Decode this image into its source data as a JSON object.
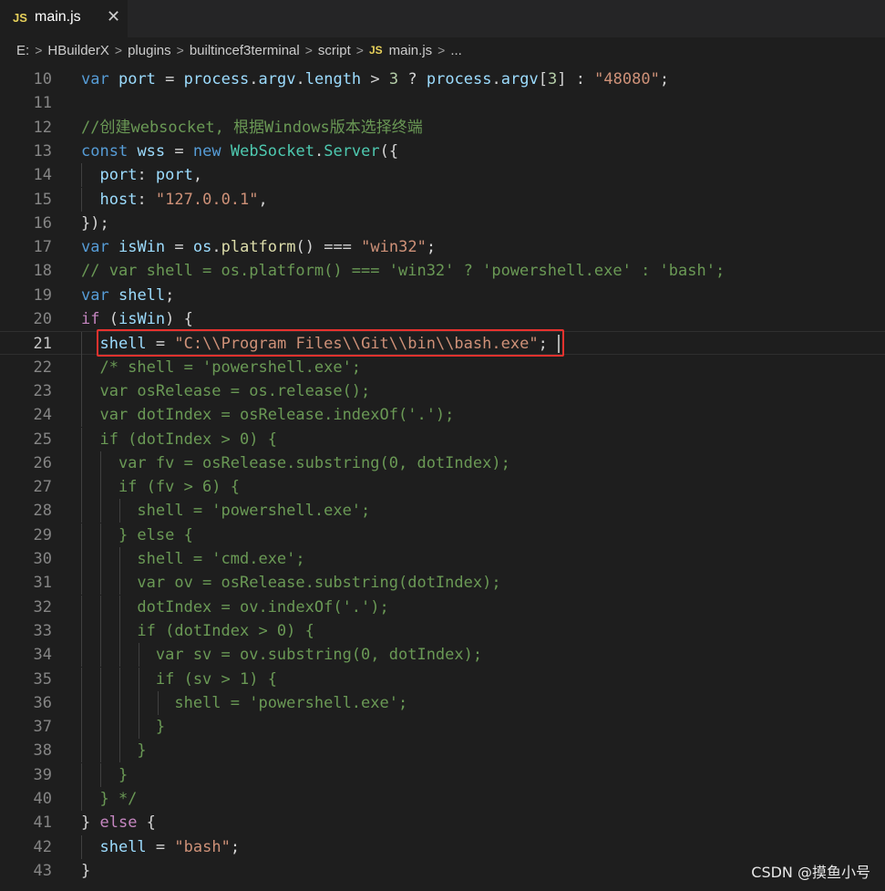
{
  "tab": {
    "badge": "JS",
    "filename": "main.js",
    "close": "✕"
  },
  "breadcrumb": {
    "items": [
      "E:",
      "HBuilderX",
      "plugins",
      "builtincef3terminal",
      "script",
      "main.js",
      "..."
    ],
    "badge": "JS",
    "separator": ">"
  },
  "editor": {
    "current_line": 21,
    "lines": [
      {
        "n": "10",
        "indent": 0,
        "t": [
          [
            "kw",
            "var"
          ],
          [
            "op",
            " "
          ],
          [
            "var",
            "port"
          ],
          [
            "op",
            " = "
          ],
          [
            "var",
            "process"
          ],
          [
            "op",
            "."
          ],
          [
            "var",
            "argv"
          ],
          [
            "op",
            "."
          ],
          [
            "var",
            "length"
          ],
          [
            "op",
            " > "
          ],
          [
            "num",
            "3"
          ],
          [
            "op",
            " ? "
          ],
          [
            "var",
            "process"
          ],
          [
            "op",
            "."
          ],
          [
            "var",
            "argv"
          ],
          [
            "op",
            "["
          ],
          [
            "num",
            "3"
          ],
          [
            "op",
            "] : "
          ],
          [
            "str",
            "\"48080\""
          ],
          [
            "op",
            ";"
          ]
        ]
      },
      {
        "n": "11",
        "indent": 0,
        "t": []
      },
      {
        "n": "12",
        "indent": 0,
        "t": [
          [
            "cm",
            "//创建websocket, 根据Windows版本选择终端"
          ]
        ]
      },
      {
        "n": "13",
        "indent": 0,
        "t": [
          [
            "kw",
            "const"
          ],
          [
            "op",
            " "
          ],
          [
            "var",
            "wss"
          ],
          [
            "op",
            " = "
          ],
          [
            "kw",
            "new"
          ],
          [
            "op",
            " "
          ],
          [
            "cls",
            "WebSocket"
          ],
          [
            "op",
            "."
          ],
          [
            "cls",
            "Server"
          ],
          [
            "op",
            "({"
          ]
        ]
      },
      {
        "n": "14",
        "indent": 1,
        "t": [
          [
            "op",
            "  "
          ],
          [
            "var",
            "port"
          ],
          [
            "op",
            ": "
          ],
          [
            "var",
            "port"
          ],
          [
            "op",
            ","
          ]
        ]
      },
      {
        "n": "15",
        "indent": 1,
        "t": [
          [
            "op",
            "  "
          ],
          [
            "var",
            "host"
          ],
          [
            "op",
            ": "
          ],
          [
            "str",
            "\"127.0.0.1\""
          ],
          [
            "op",
            ","
          ]
        ]
      },
      {
        "n": "16",
        "indent": 0,
        "t": [
          [
            "op",
            "});"
          ]
        ]
      },
      {
        "n": "17",
        "indent": 0,
        "t": [
          [
            "kw",
            "var"
          ],
          [
            "op",
            " "
          ],
          [
            "var",
            "isWin"
          ],
          [
            "op",
            " = "
          ],
          [
            "var",
            "os"
          ],
          [
            "op",
            "."
          ],
          [
            "fn",
            "platform"
          ],
          [
            "op",
            "() === "
          ],
          [
            "str",
            "\"win32\""
          ],
          [
            "op",
            ";"
          ]
        ]
      },
      {
        "n": "18",
        "indent": 0,
        "t": [
          [
            "cm",
            "// var shell = os.platform() === 'win32' ? 'powershell.exe' : 'bash';"
          ]
        ]
      },
      {
        "n": "19",
        "indent": 0,
        "t": [
          [
            "kw",
            "var"
          ],
          [
            "op",
            " "
          ],
          [
            "var",
            "shell"
          ],
          [
            "op",
            ";"
          ]
        ]
      },
      {
        "n": "20",
        "indent": 0,
        "t": [
          [
            "ctl",
            "if"
          ],
          [
            "op",
            " ("
          ],
          [
            "var",
            "isWin"
          ],
          [
            "op",
            ") "
          ],
          [
            "op",
            "{"
          ]
        ]
      },
      {
        "n": "21",
        "indent": 1,
        "t": [
          [
            "op",
            "  "
          ],
          [
            "var",
            "shell"
          ],
          [
            "op",
            " = "
          ],
          [
            "str",
            "\"C:\\\\Program Files\\\\Git\\\\bin\\\\bash.exe\""
          ],
          [
            "op",
            ";"
          ]
        ]
      },
      {
        "n": "22",
        "indent": 1,
        "t": [
          [
            "cm",
            "  /* shell = 'powershell.exe';"
          ]
        ]
      },
      {
        "n": "23",
        "indent": 1,
        "t": [
          [
            "cm",
            "  var osRelease = os.release();"
          ]
        ]
      },
      {
        "n": "24",
        "indent": 1,
        "t": [
          [
            "cm",
            "  var dotIndex = osRelease.indexOf('.');"
          ]
        ]
      },
      {
        "n": "25",
        "indent": 1,
        "t": [
          [
            "cm",
            "  if (dotIndex > 0) {"
          ]
        ]
      },
      {
        "n": "26",
        "indent": 2,
        "t": [
          [
            "cm",
            "    var fv = osRelease.substring(0, dotIndex);"
          ]
        ]
      },
      {
        "n": "27",
        "indent": 2,
        "t": [
          [
            "cm",
            "    if (fv > 6) {"
          ]
        ]
      },
      {
        "n": "28",
        "indent": 3,
        "t": [
          [
            "cm",
            "      shell = 'powershell.exe';"
          ]
        ]
      },
      {
        "n": "29",
        "indent": 2,
        "t": [
          [
            "cm",
            "    } else {"
          ]
        ]
      },
      {
        "n": "30",
        "indent": 3,
        "t": [
          [
            "cm",
            "      shell = 'cmd.exe';"
          ]
        ]
      },
      {
        "n": "31",
        "indent": 3,
        "t": [
          [
            "cm",
            "      var ov = osRelease.substring(dotIndex);"
          ]
        ]
      },
      {
        "n": "32",
        "indent": 3,
        "t": [
          [
            "cm",
            "      dotIndex = ov.indexOf('.');"
          ]
        ]
      },
      {
        "n": "33",
        "indent": 3,
        "t": [
          [
            "cm",
            "      if (dotIndex > 0) {"
          ]
        ]
      },
      {
        "n": "34",
        "indent": 4,
        "t": [
          [
            "cm",
            "        var sv = ov.substring(0, dotIndex);"
          ]
        ]
      },
      {
        "n": "35",
        "indent": 4,
        "t": [
          [
            "cm",
            "        if (sv > 1) {"
          ]
        ]
      },
      {
        "n": "36",
        "indent": 5,
        "t": [
          [
            "cm",
            "          shell = 'powershell.exe';"
          ]
        ]
      },
      {
        "n": "37",
        "indent": 4,
        "t": [
          [
            "cm",
            "        }"
          ]
        ]
      },
      {
        "n": "38",
        "indent": 3,
        "t": [
          [
            "cm",
            "      }"
          ]
        ]
      },
      {
        "n": "39",
        "indent": 2,
        "t": [
          [
            "cm",
            "    }"
          ]
        ]
      },
      {
        "n": "40",
        "indent": 1,
        "t": [
          [
            "cm",
            "  } */"
          ]
        ]
      },
      {
        "n": "41",
        "indent": 0,
        "t": [
          [
            "op",
            "} "
          ],
          [
            "ctl",
            "else"
          ],
          [
            "op",
            " {"
          ]
        ]
      },
      {
        "n": "42",
        "indent": 1,
        "t": [
          [
            "op",
            "  "
          ],
          [
            "var",
            "shell"
          ],
          [
            "op",
            " = "
          ],
          [
            "str",
            "\"bash\""
          ],
          [
            "op",
            ";"
          ]
        ]
      },
      {
        "n": "43",
        "indent": 0,
        "t": [
          [
            "op",
            "}"
          ]
        ]
      }
    ]
  },
  "watermark": "CSDN @摸鱼小号"
}
